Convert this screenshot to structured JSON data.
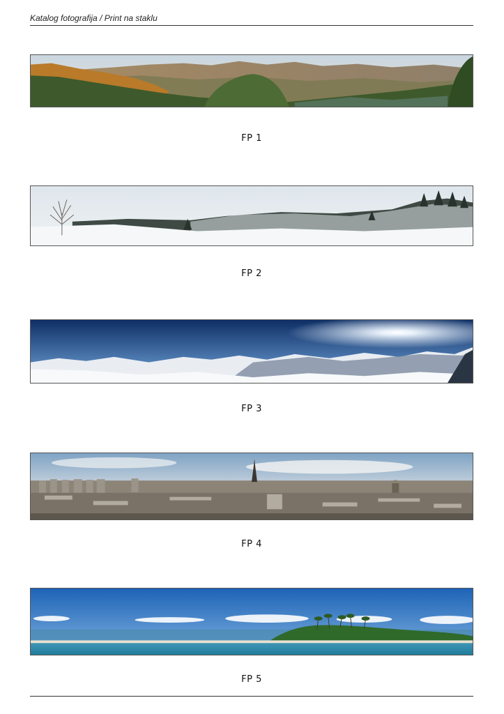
{
  "header": {
    "title": "Katalog fotografija / Print na staklu"
  },
  "photos": [
    {
      "caption": "FP 1",
      "scene": "mountain-valley-sunset"
    },
    {
      "caption": "FP 2",
      "scene": "snowy-forest"
    },
    {
      "caption": "FP 3",
      "scene": "snowy-mountains-sun"
    },
    {
      "caption": "FP 4",
      "scene": "paris-skyline"
    },
    {
      "caption": "FP 5",
      "scene": "tropical-island"
    }
  ]
}
